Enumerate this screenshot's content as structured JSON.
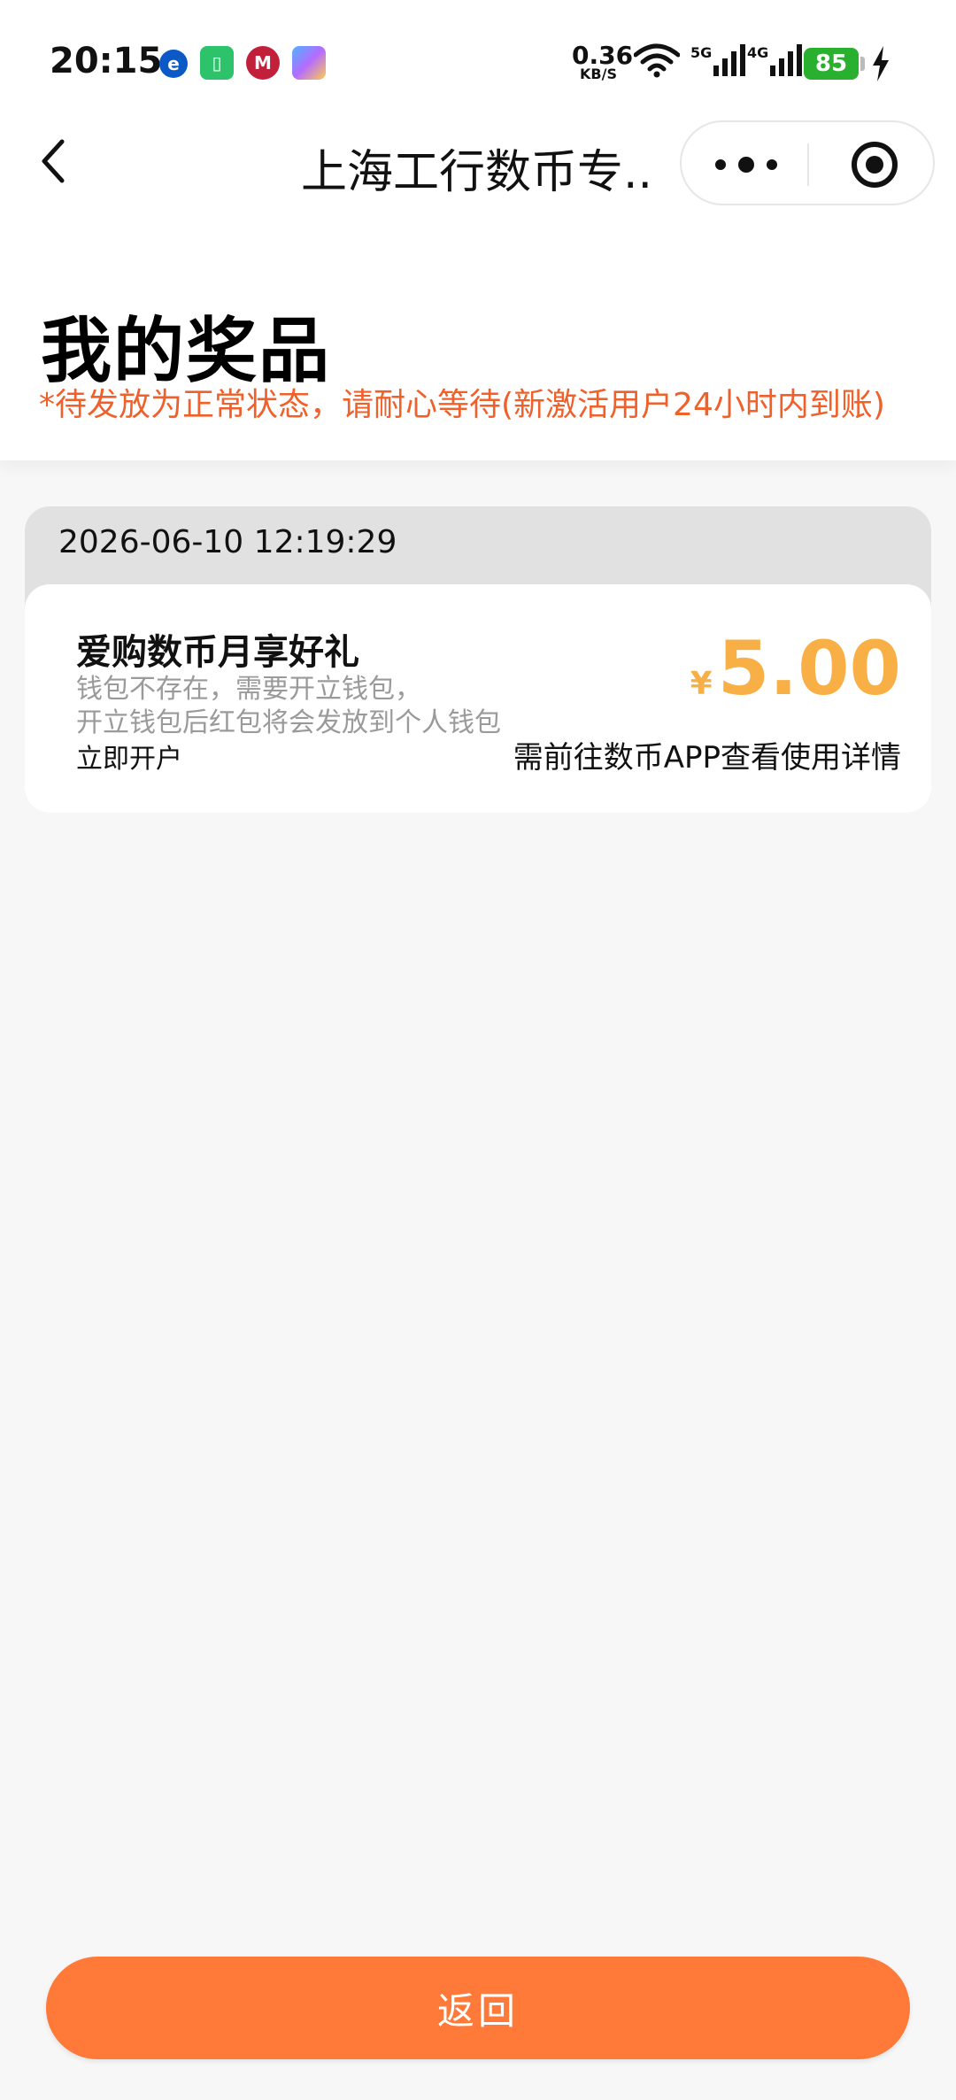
{
  "status_bar": {
    "time": "20:15",
    "speed_value": "0.36",
    "speed_unit": "KB/S",
    "net1_label": "5G",
    "net2_label": "4G",
    "battery": "85"
  },
  "nav": {
    "title": "上海工行数币专..."
  },
  "header": {
    "title": "我的奖品",
    "notice": "*待发放为正常状态，请耐心等待(新激活用户24小时内到账)"
  },
  "prizes": [
    {
      "date": "2026-06-10 12:19:29",
      "name": "爱购数币月享好礼",
      "desc_line1": "钱包不存在，需要开立钱包，",
      "desc_line2": "开立钱包后红包将会发放到个人钱包",
      "action": "立即开户",
      "currency": "¥",
      "amount": "5.00",
      "hint": "需前往数币APP查看使用详情"
    }
  ],
  "bottom": {
    "return_label": "返回"
  },
  "colors": {
    "accent": "#ff7a38",
    "notice": "#f0602a",
    "amount": "#f8b046",
    "battery": "#2ab02f"
  }
}
